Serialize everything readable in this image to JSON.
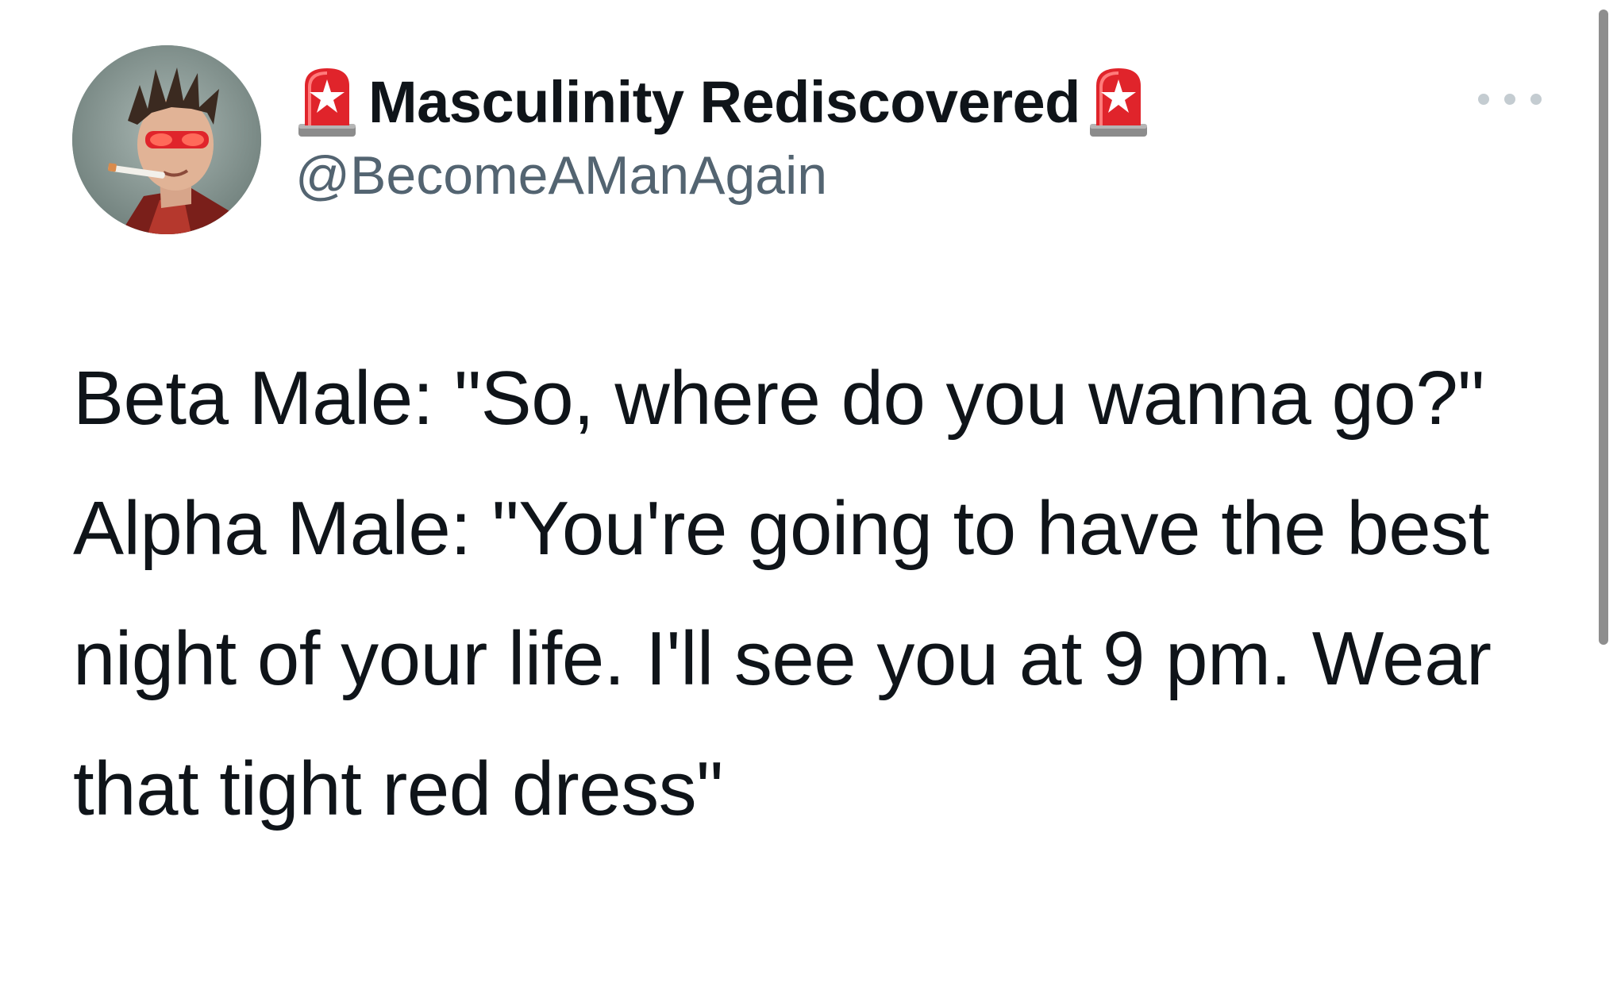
{
  "author": {
    "display_name": "Masculinity Rediscovered",
    "handle": "@BecomeAManAgain",
    "badge_left_icon": "police-siren-icon",
    "badge_right_icon": "police-siren-icon",
    "avatar_icon": "profile-avatar"
  },
  "menu": {
    "icon": "more-options-icon"
  },
  "tweet": {
    "line1": "Beta Male: \"So, where do you wanna go?\"",
    "line2": "Alpha Male: \"You're going to have the best night of your life. I'll see you at 9 pm. Wear that tight red dress\""
  },
  "colors": {
    "text": "#0f1419",
    "handle": "#536471",
    "siren_red": "#e0242b",
    "more_dots": "#c4ccd1"
  }
}
